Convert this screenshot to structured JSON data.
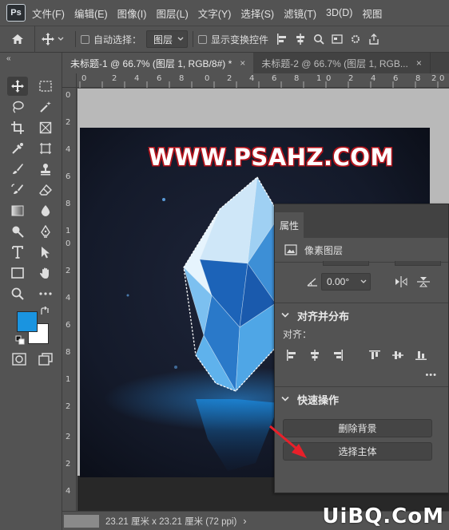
{
  "app": {
    "logo": "Ps"
  },
  "menu": [
    "文件(F)",
    "编辑(E)",
    "图像(I)",
    "图层(L)",
    "文字(Y)",
    "选择(S)",
    "滤镜(T)",
    "3D(D)",
    "视图"
  ],
  "options": {
    "auto_select_label": "自动选择：",
    "auto_select_value": "图层",
    "show_transform_label": "显示变换控件",
    "auto_select_checked": false,
    "show_transform_checked": false
  },
  "tabs": [
    {
      "label": "未标题-1 @ 66.7% (图层 1, RGB/8#) *",
      "close": "×",
      "active": true
    },
    {
      "label": "未标题-2 @ 66.7% (图层 1, RGB...",
      "close": "×",
      "active": false
    }
  ],
  "ruler": {
    "top": [
      "0",
      "2",
      "4",
      "6",
      "8",
      "0",
      "2",
      "4",
      "6",
      "8",
      "1",
      "0",
      "2",
      "4",
      "6",
      "8",
      "2",
      "0"
    ],
    "left": [
      "0",
      "2",
      "4",
      "6",
      "8",
      "1",
      "0",
      "2",
      "4",
      "6",
      "8",
      "1",
      "2",
      "2",
      "2",
      "4"
    ]
  },
  "canvas": {
    "headline": "WWW.PSAHZ.COM",
    "colors": {
      "foreground": "#1a94e0",
      "background": "#ffffff"
    }
  },
  "properties": {
    "tab": "属性",
    "layer_type": "像素图层",
    "angle": "0.00°",
    "align_section": "对齐并分布",
    "align_label": "对齐：",
    "more": "•••",
    "quick_section": "快速操作",
    "remove_bg": "删除背景",
    "select_subject": "选择主体"
  },
  "status": {
    "text": "23.21 厘米 x 23.21 厘米 (72 ppi)",
    "arrow": "›"
  },
  "watermark": "UiBQ.CoM"
}
